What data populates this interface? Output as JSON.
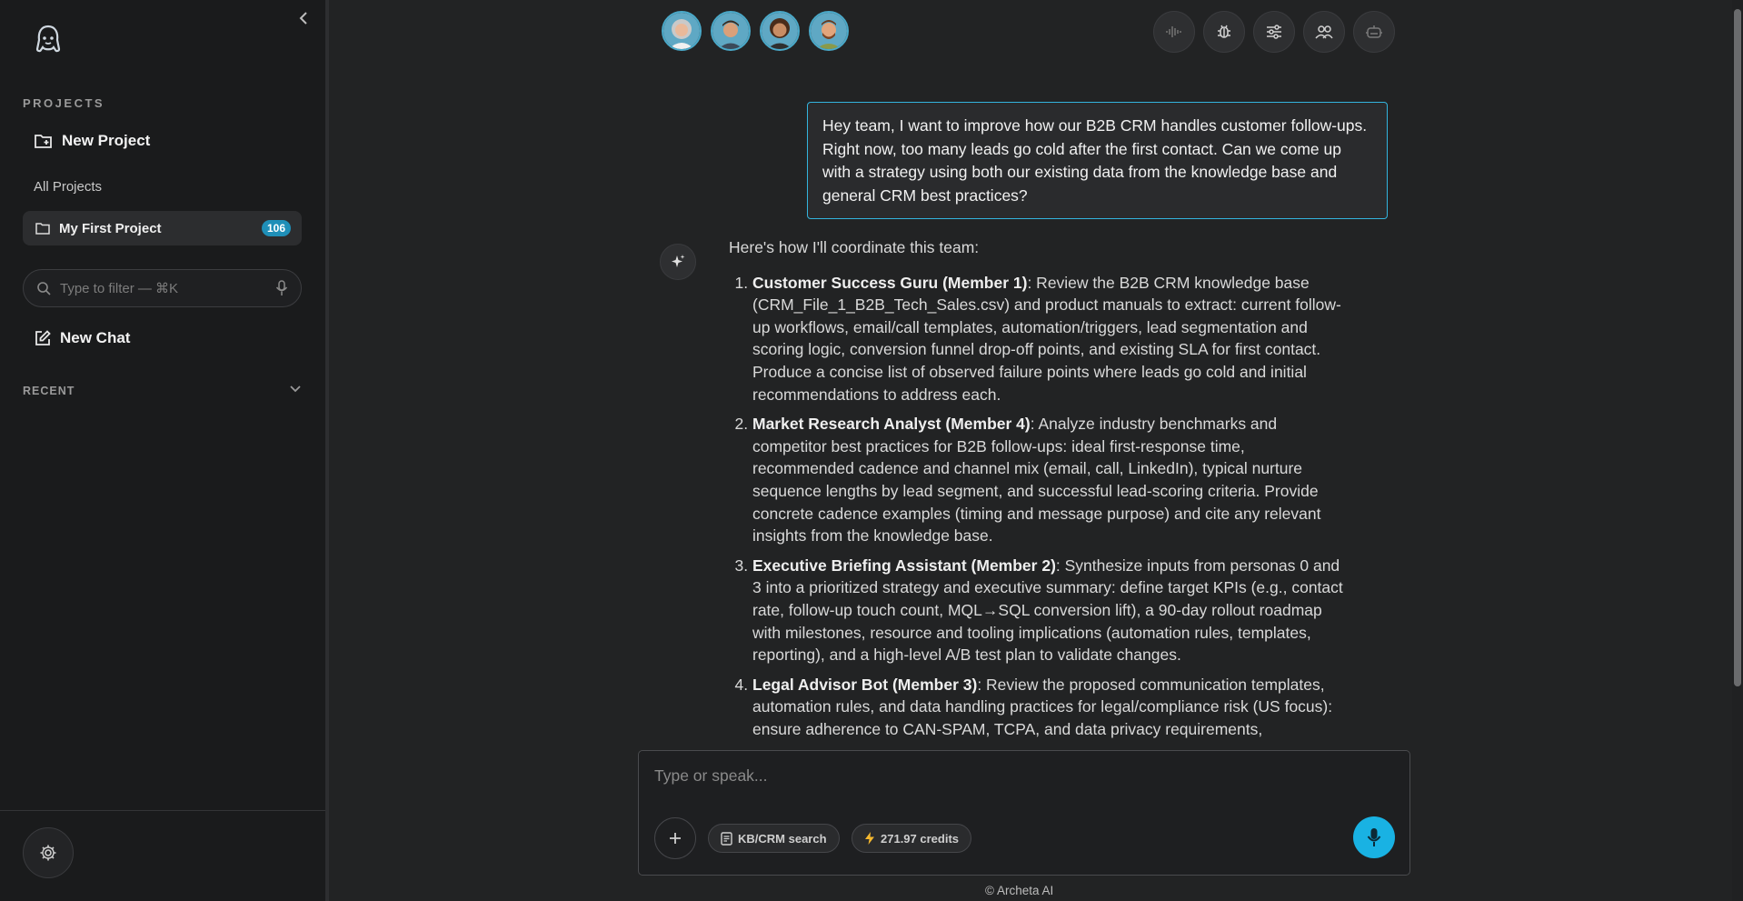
{
  "sidebar": {
    "projects_label": "PROJECTS",
    "new_project": "New Project",
    "all_projects": "All Projects",
    "projects": [
      {
        "name": "My First Project",
        "count": "106"
      }
    ],
    "filter_placeholder": "Type to filter — ⌘K",
    "new_chat": "New Chat",
    "recent_label": "RECENT"
  },
  "user_message": "Hey team, I want to improve how our B2B CRM handles customer follow-ups. Right now, too many leads go cold after the first contact. Can we come up with a strategy using both our existing data from the knowledge base and general CRM best practices?",
  "assistant": {
    "intro": "Here's how I'll coordinate this team:",
    "items": [
      {
        "title": "Customer Success Guru (Member 1)",
        "text": ": Review the B2B CRM knowledge base (CRM_File_1_B2B_Tech_Sales.csv) and product manuals to extract: current follow-up workflows, email/call templates, automation/triggers, lead segmentation and scoring logic, conversion funnel drop-off points, and existing SLA for first contact. Produce a concise list of observed failure points where leads go cold and initial recommendations to address each."
      },
      {
        "title": "Market Research Analyst (Member 4)",
        "text": ": Analyze industry benchmarks and competitor best practices for B2B follow-ups: ideal first-response time, recommended cadence and channel mix (email, call, LinkedIn), typical nurture sequence lengths by lead segment, and successful lead-scoring criteria. Provide concrete cadence examples (timing and message purpose) and cite any relevant insights from the knowledge base."
      },
      {
        "title": "Executive Briefing Assistant (Member 2)",
        "text": ": Synthesize inputs from personas 0 and 3 into a prioritized strategy and executive summary: define target KPIs (e.g., contact rate, follow-up touch count, MQL→SQL conversion lift), a 90-day rollout roadmap with milestones, resource and tooling implications (automation rules, templates, reporting), and a high-level A/B test plan to validate changes."
      },
      {
        "title": "Legal Advisor Bot (Member 3)",
        "text": ": Review the proposed communication templates, automation rules, and data handling practices for legal/compliance risk (US focus): ensure adherence to CAN-SPAM, TCPA, and data privacy requirements,"
      }
    ]
  },
  "composer": {
    "placeholder": "Type or speak...",
    "kb_chip": "KB/CRM search",
    "credits_chip": "271.97 credits"
  },
  "footer": "© Archeta AI",
  "colors": {
    "accent": "#19b2e3",
    "badge": "#1f8fb8",
    "background": "#222324",
    "sidebar": "#1a1b1c"
  }
}
